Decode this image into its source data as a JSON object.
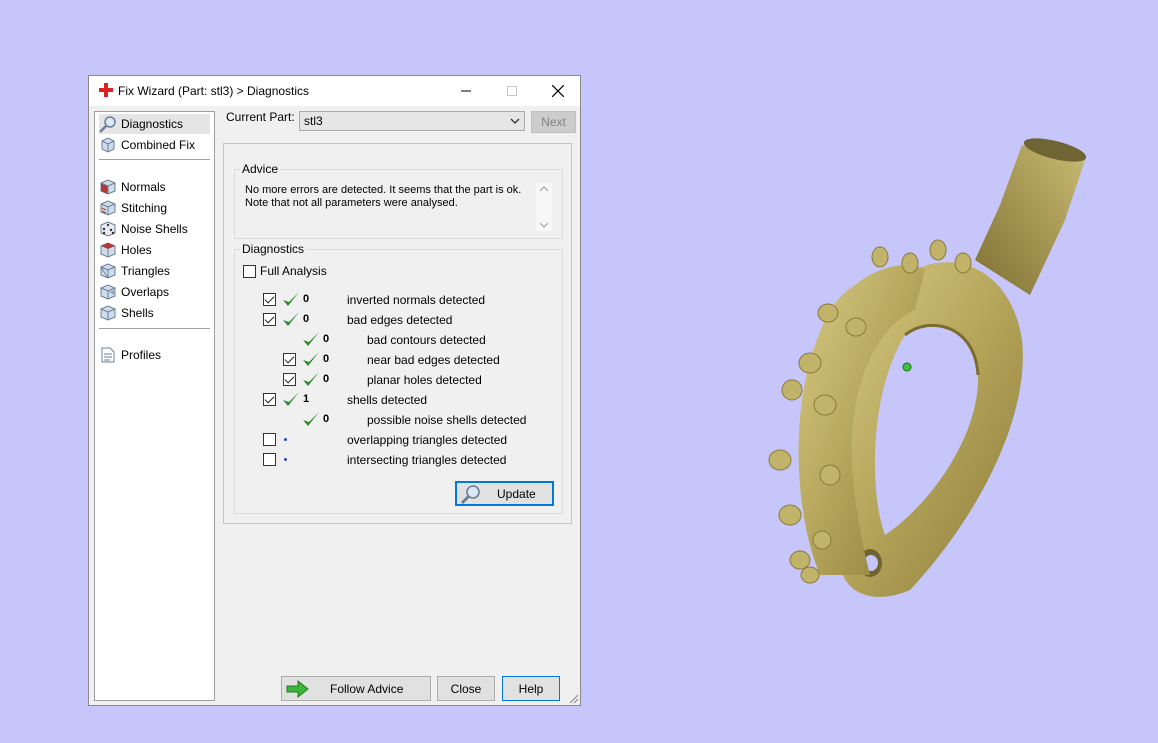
{
  "window": {
    "title": "Fix Wizard (Part: stl3) > Diagnostics",
    "icons": {
      "app": "red-cross-icon",
      "minimize": "minimize-icon",
      "maximize": "maximize-icon",
      "close": "close-icon"
    }
  },
  "sidebar": {
    "items": [
      {
        "label": "Diagnostics",
        "icon": "magnifier-icon",
        "selected": true
      },
      {
        "label": "Combined Fix",
        "icon": "cube-icon"
      },
      {
        "label": "Normals",
        "icon": "normals-cube-icon"
      },
      {
        "label": "Stitching",
        "icon": "stitching-cube-icon"
      },
      {
        "label": "Noise Shells",
        "icon": "dice-icon"
      },
      {
        "label": "Holes",
        "icon": "holes-cube-icon"
      },
      {
        "label": "Triangles",
        "icon": "triangles-cube-icon"
      },
      {
        "label": "Overlaps",
        "icon": "overlaps-cube-icon"
      },
      {
        "label": "Shells",
        "icon": "shells-cube-icon"
      },
      {
        "label": "Profiles",
        "icon": "document-icon"
      }
    ]
  },
  "current_part": {
    "label": "Current Part:",
    "value": "stl3",
    "next_label": "Next"
  },
  "advice": {
    "title": "Advice",
    "line1": "No more errors are detected. It seems that the part is ok.",
    "line2": "Note that not all parameters were analysed."
  },
  "diagnostics": {
    "title": "Diagnostics",
    "full_analysis_label": "Full Analysis",
    "full_analysis_checked": false,
    "rows": [
      {
        "checkbox": true,
        "checked": true,
        "status": "ok",
        "count": "0",
        "label": "inverted normals detected",
        "indent": 0
      },
      {
        "checkbox": true,
        "checked": true,
        "status": "ok",
        "count": "0",
        "label": "bad edges detected",
        "indent": 0
      },
      {
        "checkbox": false,
        "status": "ok",
        "count": "0",
        "label": "bad contours detected",
        "indent": 1
      },
      {
        "checkbox": true,
        "checked": true,
        "status": "ok",
        "count": "0",
        "label": "near bad edges detected",
        "indent": 1
      },
      {
        "checkbox": true,
        "checked": true,
        "status": "ok",
        "count": "0",
        "label": "planar holes detected",
        "indent": 1
      },
      {
        "checkbox": true,
        "checked": true,
        "status": "ok",
        "count": "1",
        "label": "shells detected",
        "indent": 0
      },
      {
        "checkbox": false,
        "status": "ok",
        "count": "0",
        "label": "possible noise shells detected",
        "indent": 1
      },
      {
        "checkbox": true,
        "checked": false,
        "status": "pending",
        "count": "",
        "label": "overlapping triangles detected",
        "indent": 0
      },
      {
        "checkbox": true,
        "checked": false,
        "status": "pending",
        "count": "",
        "label": "intersecting triangles detected",
        "indent": 0
      }
    ],
    "update_label": "Update"
  },
  "buttons": {
    "follow_advice": "Follow Advice",
    "close": "Close",
    "help": "Help"
  },
  "colors": {
    "desktop": "#c7c6fb",
    "check_green": "#2e8b2e",
    "model_gold": "#b8a95e",
    "focus_blue": "#0078d7"
  }
}
